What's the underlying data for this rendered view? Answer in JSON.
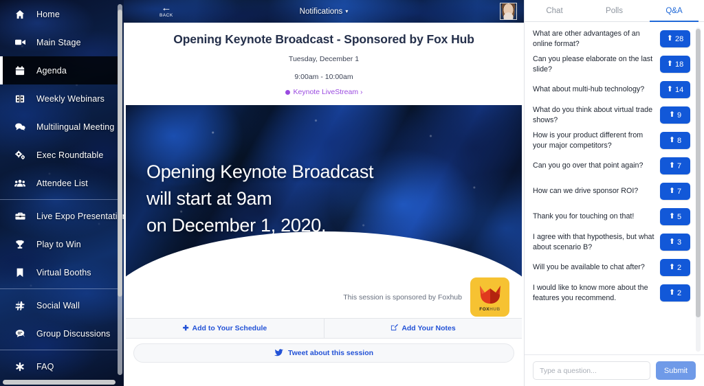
{
  "sidebar": {
    "items": [
      {
        "label": "Home",
        "icon": "home-icon",
        "active": false,
        "divider_after": false
      },
      {
        "label": "Main Stage",
        "icon": "video-camera-icon",
        "active": false,
        "divider_after": false
      },
      {
        "label": "Agenda",
        "icon": "calendar-icon",
        "active": true,
        "divider_after": false
      },
      {
        "label": "Weekly Webinars",
        "icon": "film-icon",
        "active": false,
        "divider_after": false
      },
      {
        "label": "Multilingual Meeting",
        "icon": "chat-bubbles-icon",
        "active": false,
        "divider_after": false
      },
      {
        "label": "Exec Roundtable",
        "icon": "gears-icon",
        "active": false,
        "divider_after": false
      },
      {
        "label": "Attendee List",
        "icon": "people-icon",
        "active": false,
        "divider_after": true
      },
      {
        "label": "Live Expo Presentations",
        "icon": "briefcase-icon",
        "active": false,
        "divider_after": false
      },
      {
        "label": "Play to Win",
        "icon": "trophy-icon",
        "active": false,
        "divider_after": false
      },
      {
        "label": "Virtual Booths",
        "icon": "bookmark-icon",
        "active": false,
        "divider_after": true
      },
      {
        "label": "Social Wall",
        "icon": "hashtag-icon",
        "active": false,
        "divider_after": false
      },
      {
        "label": "Group Discussions",
        "icon": "discussion-icon",
        "active": false,
        "divider_after": true
      },
      {
        "label": "FAQ",
        "icon": "asterisk-icon",
        "active": false,
        "divider_after": false
      }
    ]
  },
  "topbar": {
    "back_label": "BACK",
    "back_icon": "arrow-left-icon",
    "notifications_label": "Notifications",
    "notifications_caret": "▾",
    "avatar_name": "user-avatar"
  },
  "session": {
    "title": "Opening Keynote Broadcast - Sponsored by Fox Hub",
    "date": "Tuesday, December 1",
    "time": "9:00am - 10:00am",
    "livestream_label": "Keynote LiveStream ›",
    "livestream_color": "#9a4ae0",
    "banner_text": "Opening Keynote Broadcast\nwill start at 9am\non December 1, 2020.",
    "sponsor_text": "This session is sponsored by Foxhub",
    "sponsor_logo": {
      "name_bold": "FOX",
      "name_light": "HUB",
      "bg_color": "#f6c232",
      "fox_color": "#e03a1e"
    },
    "actions": [
      {
        "label": "Add to Your Schedule",
        "icon": "plus-icon"
      },
      {
        "label": "Add Your Notes",
        "icon": "pencil-square-icon"
      }
    ],
    "tweet_label": "Tweet about this session",
    "tweet_icon": "twitter-bird-icon",
    "link_color": "#2352d6"
  },
  "panel": {
    "tabs": [
      {
        "label": "Chat",
        "active": false
      },
      {
        "label": "Polls",
        "active": false
      },
      {
        "label": "Q&A",
        "active": true
      }
    ],
    "active_color": "#2069d8",
    "vote_color": "#1258d8",
    "questions": [
      {
        "text": "What are other advantages of an online format?",
        "votes": "28"
      },
      {
        "text": "Can you please elaborate on the last slide?",
        "votes": "18"
      },
      {
        "text": "What about multi-hub technology?",
        "votes": "14"
      },
      {
        "text": "What do you think about virtual trade shows?",
        "votes": "9"
      },
      {
        "text": "How is your product different from your major competitors?",
        "votes": "8"
      },
      {
        "text": "Can you go over that point again?",
        "votes": "7"
      },
      {
        "text": "How can we drive sponsor ROI?",
        "votes": "7"
      },
      {
        "text": "Thank you for touching on that!",
        "votes": "5"
      },
      {
        "text": "I agree with that hypothesis, but what about scenario B?",
        "votes": "3"
      },
      {
        "text": "Will you be available to chat after?",
        "votes": "2"
      },
      {
        "text": "I would like to know more about the features you recommend.",
        "votes": "2"
      }
    ],
    "compose": {
      "placeholder": "Type a question...",
      "value": "",
      "submit_label": "Submit"
    }
  }
}
